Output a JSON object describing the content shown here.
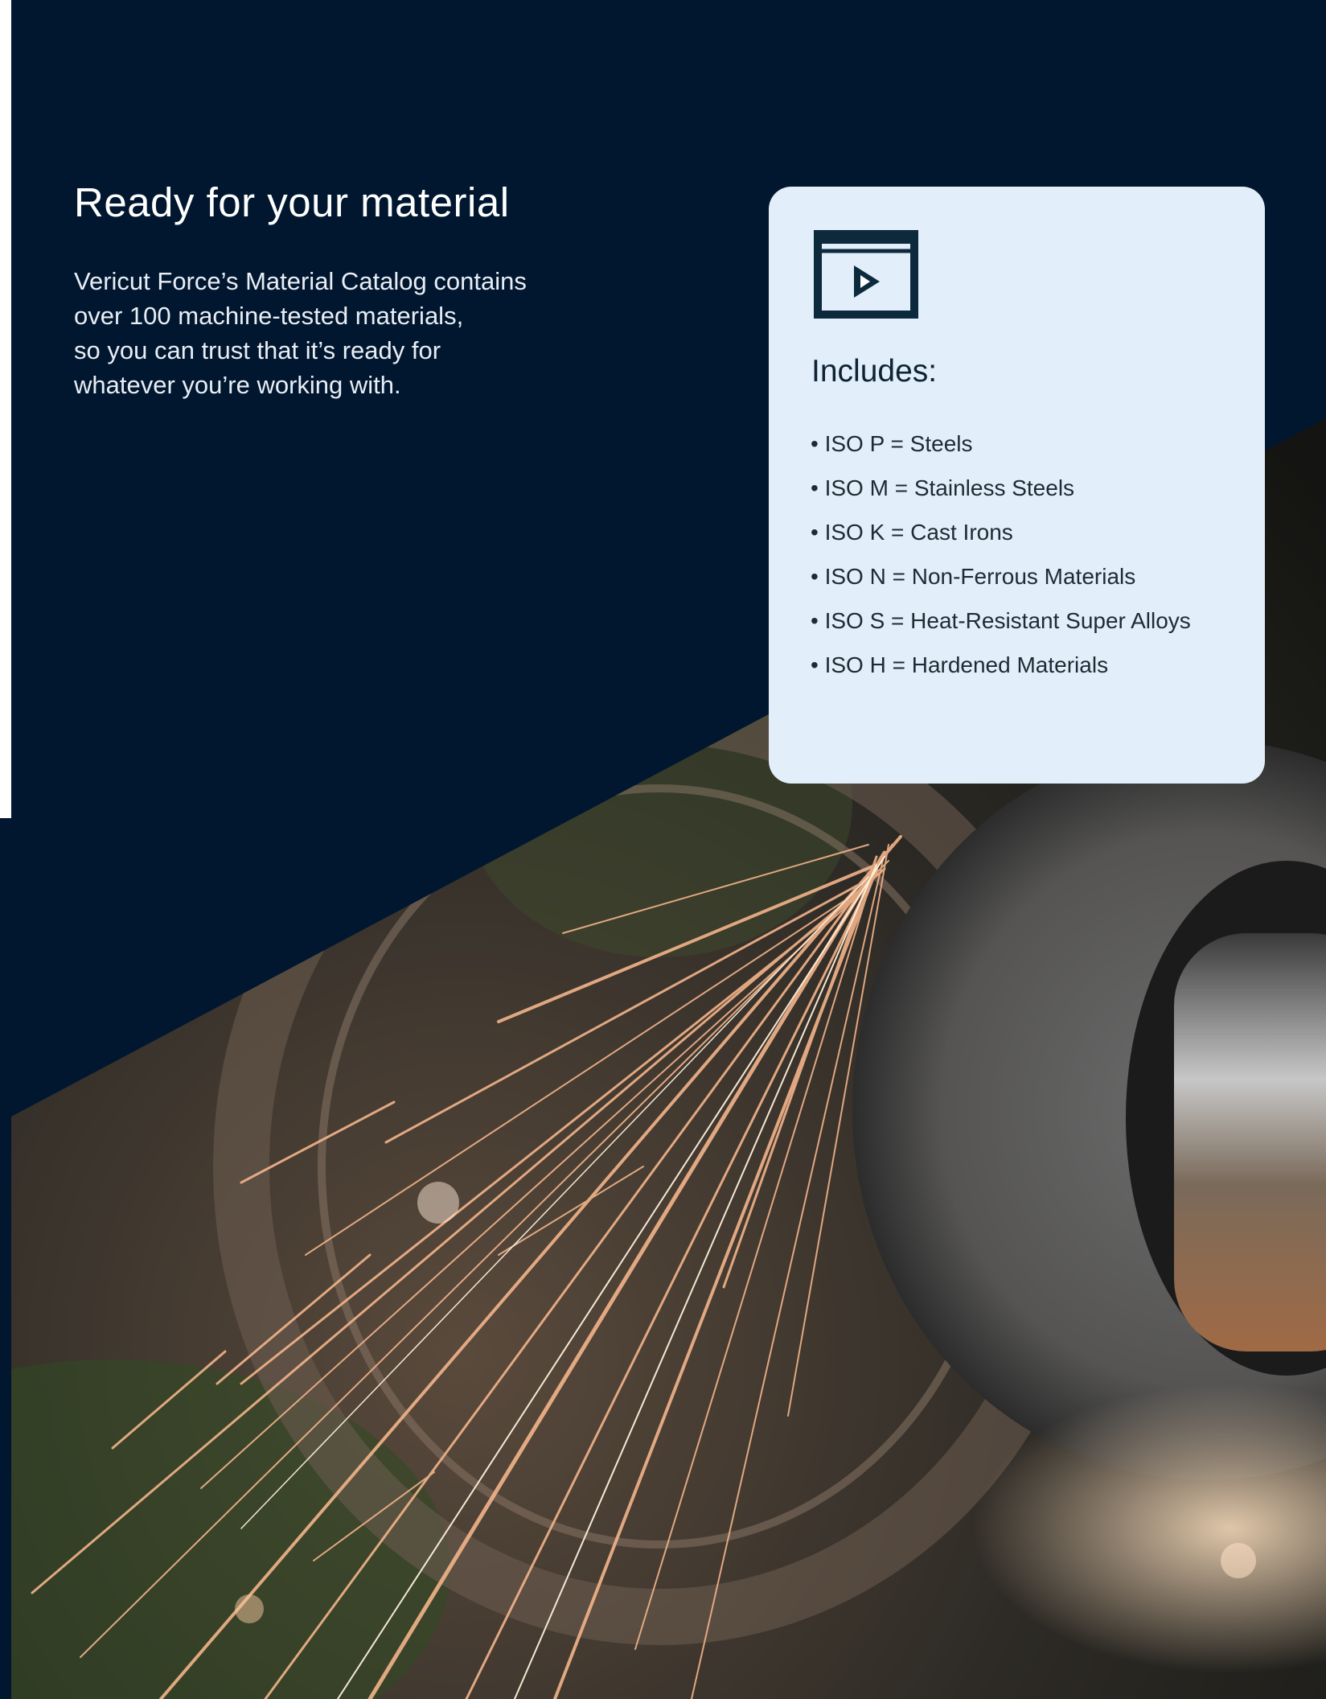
{
  "headline": "Ready for your material",
  "lede": [
    "Vericut Force’s Material Catalog contains",
    "over 100 machine-tested materials,",
    "so you can trust that it’s ready for",
    "whatever you’re working with."
  ],
  "card": {
    "icon": "video-player-icon",
    "title": "Includes:",
    "items": [
      "•  ISO P = Steels",
      "• ISO M = Stainless Steels",
      "• ISO K = Cast Irons",
      "• ISO N = Non-Ferrous Materials",
      "• ISO S = Heat-Resistant Super Alloys",
      "• ISO H = Hardened Materials"
    ]
  },
  "photo": "grinding wheel with sparks",
  "colors": {
    "background": "#01172f",
    "card": "#e2eef9",
    "card_text": "#0e2433",
    "icon": "#0d2a3d"
  }
}
